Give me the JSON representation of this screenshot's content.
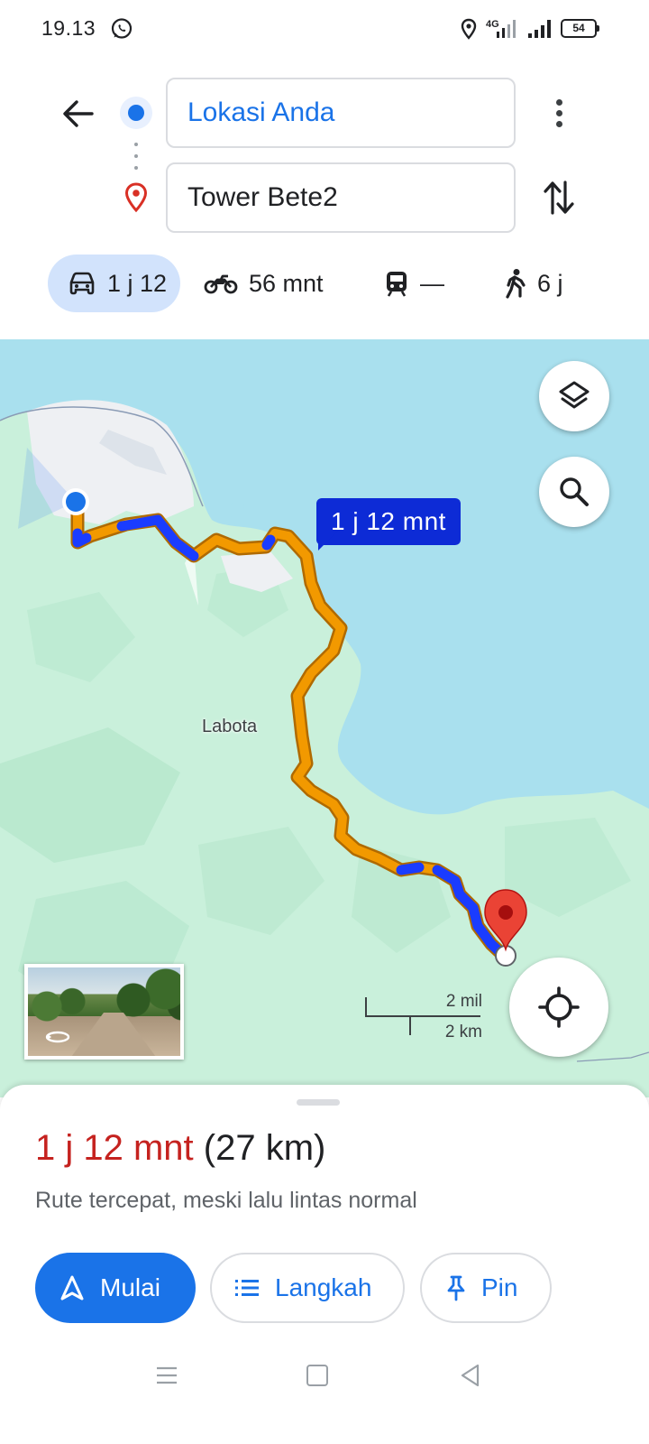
{
  "status_bar": {
    "time": "19.13",
    "network": "4G",
    "battery": "54"
  },
  "directions": {
    "origin": "Lokasi Anda",
    "destination": "Tower Bete2"
  },
  "modes": [
    {
      "name": "car",
      "label": "1 j 12",
      "active": true
    },
    {
      "name": "motorcycle",
      "label": "56 mnt",
      "active": false
    },
    {
      "name": "transit",
      "label": "—",
      "active": false
    },
    {
      "name": "walk",
      "label": "6 j",
      "active": false
    }
  ],
  "map": {
    "place_label": "Labota",
    "eta_bubble": "1 j 12 mnt",
    "scale_mi": "2 mil",
    "scale_km": "2 km"
  },
  "summary": {
    "duration": "1 j 12 mnt",
    "distance": "(27 km)",
    "description": "Rute tercepat, meski lalu lintas normal"
  },
  "actions": {
    "start": "Mulai",
    "steps": "Langkah",
    "pin": "Pin"
  },
  "colors": {
    "accent": "#1a73e8",
    "duration": "#c5221f",
    "route_orange": "#f29900",
    "route_blue": "#1a3cff",
    "water": "#a9e0ee",
    "land": "#c9f0db"
  }
}
